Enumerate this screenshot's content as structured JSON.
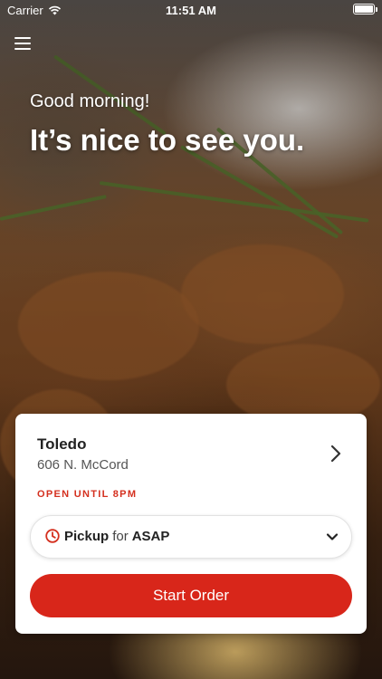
{
  "status_bar": {
    "carrier": "Carrier",
    "time": "11:51 AM"
  },
  "hero": {
    "greeting": "Good morning!",
    "headline": "It’s nice to see you."
  },
  "location": {
    "name": "Toledo",
    "address": "606 N. McCord",
    "hours": "OPEN UNTIL 8PM"
  },
  "order_mode": {
    "mode": "Pickup",
    "connector": "for",
    "time": "ASAP"
  },
  "actions": {
    "start_label": "Start Order"
  },
  "colors": {
    "accent": "#d8261a",
    "hours_text": "#d4301f"
  },
  "icons": [
    "wifi-icon",
    "battery-icon",
    "menu-icon",
    "chevron-right-icon",
    "clock-icon",
    "chevron-down-icon"
  ]
}
